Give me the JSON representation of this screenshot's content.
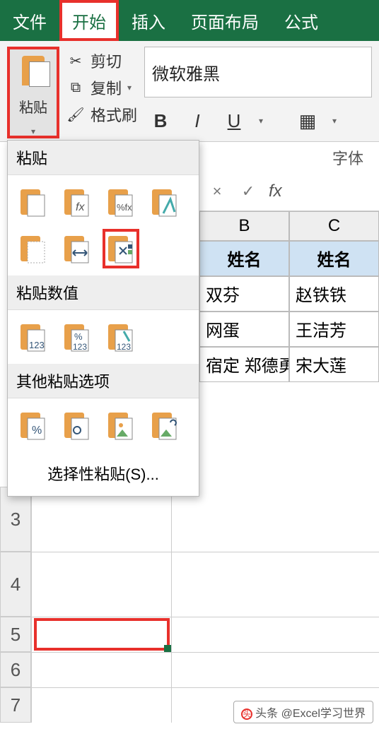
{
  "tabs": {
    "file": "文件",
    "home": "开始",
    "insert": "插入",
    "layout": "页面布局",
    "formula": "公式"
  },
  "clipboard": {
    "paste": "粘贴",
    "cut": "剪切",
    "copy": "复制",
    "formatpainter": "格式刷"
  },
  "font": {
    "name": "微软雅黑",
    "group_label": "字体"
  },
  "dropdown": {
    "h1": "粘贴",
    "h2": "粘贴数值",
    "h3": "其他粘贴选项",
    "special": "选择性粘贴(S)..."
  },
  "fx": {
    "label": "fx"
  },
  "grid": {
    "cols": [
      "B",
      "C"
    ],
    "header_row": [
      "姓名",
      "姓名"
    ],
    "rows": [
      [
        "双芬",
        "赵铁铁"
      ],
      [
        "网蛋",
        "王洁芳"
      ],
      [
        "宿定 郑德勇",
        "宋大莲"
      ]
    ],
    "row_labels": [
      "3",
      "4",
      "5",
      "6",
      "7"
    ]
  },
  "watermark": "头条 @Excel学习世界"
}
